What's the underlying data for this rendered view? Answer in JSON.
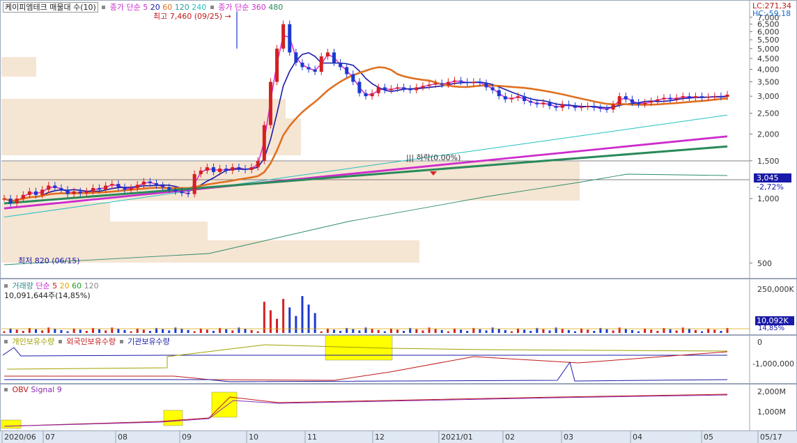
{
  "title": "케이피엠테크 매물대 수(10)",
  "ma_legend_1": {
    "label": "종가 단순",
    "periods": [
      "5",
      "20",
      "60",
      "120",
      "240"
    ],
    "colors": [
      "#cc2ccc",
      "#1a1aa8",
      "#e07020",
      "#2a9a9a",
      "#20c0c0"
    ]
  },
  "ma_legend_2": {
    "label": "종가 단순",
    "periods": [
      "360",
      "480"
    ],
    "colors": [
      "#cc2ccc",
      "#2a8a5a"
    ]
  },
  "high_label": "최고 7,460 (09/25)",
  "low_label": "최저 820 (06/15)",
  "lc_label": "LC:271,34",
  "hc_label": "HC:-59,18",
  "price_current": "3,045",
  "price_change": "-2,72%",
  "drop_label": "||| 하락(0.00%)",
  "price_axis": [
    "7,000",
    "6,500",
    "6,000",
    "5,500",
    "5,000",
    "4,500",
    "4,000",
    "3,500",
    "3,000",
    "2,500",
    "2,000",
    "1,500",
    "1,000",
    "500"
  ],
  "volume_panel": {
    "title": "거래량",
    "ma_label": "단순",
    "periods": [
      "5",
      "20",
      "60",
      "120"
    ],
    "colors": [
      "#c01818",
      "#d8a800",
      "#18a018",
      "#888888"
    ],
    "value": "10,091,644주(14,85%)",
    "axis": [
      "250,000K"
    ],
    "current": "10,092K",
    "pct": "14,85%"
  },
  "holdings_panel": {
    "series": [
      "개인보유수량",
      "외국인보유수량",
      "기관보유수량"
    ],
    "colors": [
      "#a0a000",
      "#c01818",
      "#1a1aa8"
    ],
    "axis": [
      "0",
      "-1,000,000"
    ]
  },
  "obv_panel": {
    "series": [
      "OBV",
      "Signal 9"
    ],
    "colors": [
      "#c01818",
      "#8a2ab0"
    ],
    "axis": [
      "2,000M",
      "1,000M"
    ]
  },
  "x_axis": [
    "2020/06",
    "07",
    "08",
    "09",
    "10",
    "11",
    "12",
    "2021/01",
    "02",
    "03",
    "04",
    "05",
    "05/17"
  ],
  "chart_data": {
    "type": "candlestick",
    "ylim": [
      500,
      7460
    ],
    "y_scale": "log",
    "price_line": [
      1000,
      950,
      1000,
      1040,
      1080,
      1040,
      1100,
      1150,
      1120,
      1100,
      1050,
      1080,
      1060,
      1080,
      1120,
      1100,
      1150,
      1170,
      1130,
      1100,
      1120,
      1160,
      1200,
      1180,
      1150,
      1130,
      1100,
      1080,
      1060,
      1050,
      1300,
      1350,
      1400,
      1330,
      1380,
      1350,
      1400,
      1380,
      1360,
      1400,
      1500,
      2200,
      3500,
      5000,
      6500,
      4800,
      4300,
      4100,
      4000,
      3900,
      4600,
      4800,
      4300,
      4100,
      3800,
      3500,
      3100,
      3000,
      3100,
      3300,
      3200,
      3250,
      3300,
      3250,
      3200,
      3300,
      3350,
      3400,
      3450,
      3400,
      3500,
      3550,
      3500,
      3450,
      3500,
      3450,
      3300,
      3200,
      3000,
      2900,
      2950,
      3000,
      2850,
      2800,
      2750,
      2800,
      2700,
      2650,
      2750,
      2700,
      2650,
      2680,
      2700,
      2650,
      2620,
      2600,
      2750,
      3000,
      2900,
      2800,
      2750,
      2800,
      2850,
      2900,
      2950,
      2900,
      2950,
      3000,
      2950,
      3000,
      2950,
      2980,
      3000,
      2980,
      3050
    ],
    "markers": {
      "high": 7460,
      "low": 820
    },
    "volume_note": "10,091,644주(14,85%)"
  }
}
